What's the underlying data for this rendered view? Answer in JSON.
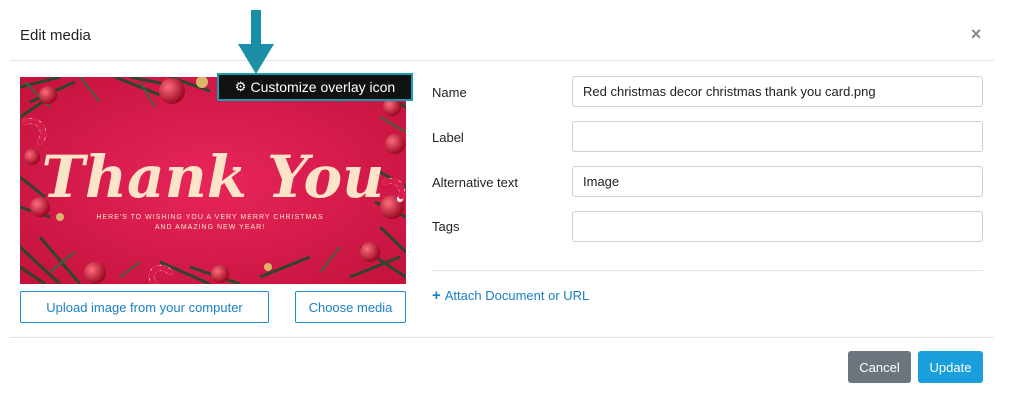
{
  "dialog": {
    "title": "Edit media",
    "close_label": "×"
  },
  "preview": {
    "overlay_button_label": "Customize overlay icon",
    "image_heading": "Thank You",
    "image_subline_1": "HERE'S TO WISHING YOU A VERY MERRY CHRISTMAS",
    "image_subline_2": "AND AMAZING NEW YEAR!",
    "upload_button_label": "Upload image from your computer",
    "choose_button_label": "Choose media"
  },
  "form": {
    "fields": [
      {
        "label": "Name",
        "value": "Red christmas decor christmas thank you card.png"
      },
      {
        "label": "Label",
        "value": ""
      },
      {
        "label": "Alternative text",
        "value": "Image"
      },
      {
        "label": "Tags",
        "value": ""
      }
    ],
    "attach_link_label": "Attach Document or URL"
  },
  "footer": {
    "cancel_label": "Cancel",
    "update_label": "Update"
  },
  "colors": {
    "accent": "#1a9fdc",
    "arrow": "#1a8fa6",
    "card_red": "#d81c4a",
    "cancel_gray": "#6c757d"
  }
}
